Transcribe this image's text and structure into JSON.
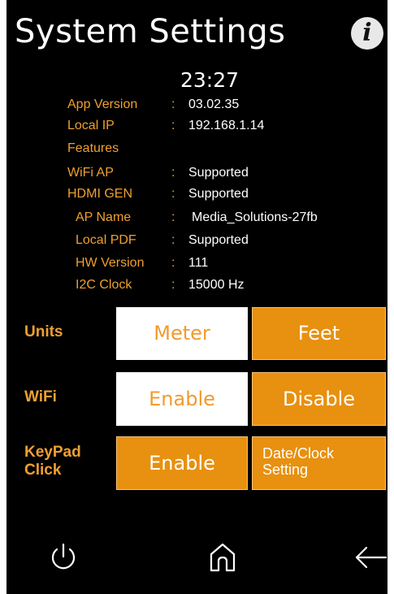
{
  "header": {
    "title": "System Settings",
    "info_icon": "info-icon"
  },
  "clock": "23:27",
  "info_rows": [
    {
      "label": "App Version",
      "sep": ":",
      "value": "03.02.35"
    },
    {
      "label": "Local IP",
      "sep": ":",
      "value": "192.168.1.14"
    },
    {
      "label": "Features",
      "sep": "",
      "value": ""
    },
    {
      "label": "WiFi AP",
      "sep": ":",
      "value": "Supported"
    },
    {
      "label": "HDMI GEN",
      "sep": ":",
      "value": "Supported"
    },
    {
      "label": "AP Name",
      "sep": ":",
      "value": "Media_Solutions-27fb"
    },
    {
      "label": "Local PDF",
      "sep": ":",
      "value": "Supported"
    },
    {
      "label": "HW Version",
      "sep": ":",
      "value": "111"
    },
    {
      "label": "I2C Clock",
      "sep": ":",
      "value": "15000  Hz"
    }
  ],
  "units": {
    "label": "Units",
    "meter": "Meter",
    "feet": "Feet"
  },
  "wifi": {
    "label": "WiFi",
    "enable": "Enable",
    "disable": "Disable"
  },
  "keypad": {
    "label_line1": "KeyPad",
    "label_line2": "Click",
    "enable": "Enable",
    "date_line1": "Date/Clock",
    "date_line2": "Setting"
  },
  "nav": {
    "power_icon": "power-icon",
    "home_icon": "home-icon",
    "back_icon": "back-icon"
  },
  "colors": {
    "accent": "#f0a030",
    "button_orange": "#e8900f",
    "background": "#000000"
  }
}
